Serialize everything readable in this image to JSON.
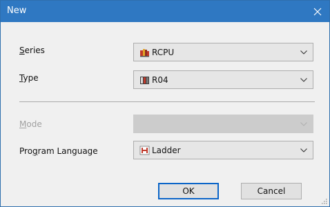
{
  "window": {
    "title": "New",
    "title_bar_color": "#2f78c2"
  },
  "form": {
    "series": {
      "label": "Series",
      "mnemonic": "S",
      "label_rest": "eries",
      "value": "RCPU",
      "icon": "rcpu-series-icon"
    },
    "type": {
      "label": "Type",
      "mnemonic": "T",
      "label_rest": "ype",
      "value": "R04",
      "icon": "r04-cpu-icon"
    },
    "mode": {
      "label": "Mode",
      "mnemonic": "M",
      "label_rest": "ode",
      "value": "",
      "enabled": false
    },
    "program_language": {
      "label": "Program Language",
      "label_pre": "Pro",
      "mnemonic": "g",
      "label_rest": "ram Language",
      "value": "Ladder",
      "icon": "ladder-icon"
    }
  },
  "buttons": {
    "ok": "OK",
    "cancel": "Cancel"
  },
  "colors": {
    "dialog_bg": "#f0f0f0",
    "combo_bg": "#e6e6e6",
    "default_button_border": "#0a64c8"
  }
}
